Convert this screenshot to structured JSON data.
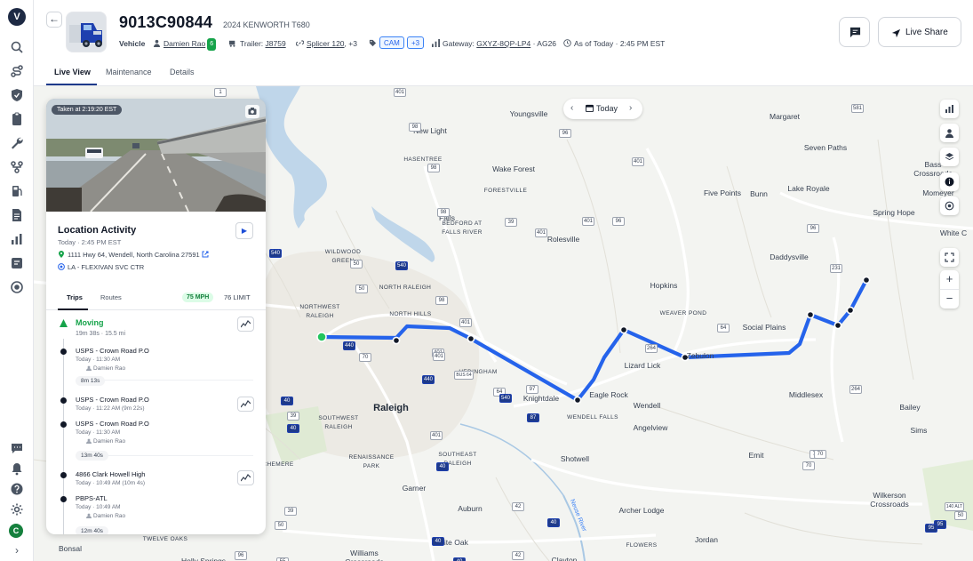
{
  "nav": {
    "logo_letter": "V",
    "items": [
      "search-icon",
      "route-icon",
      "shield-icon",
      "clipboard-icon",
      "wrench-icon",
      "workflow-icon",
      "fuel-icon",
      "document-icon",
      "chart-icon",
      "message-icon",
      "settings-circle-icon"
    ],
    "bottom": [
      "chat-icon",
      "bell-icon",
      "help-icon",
      "gear-icon"
    ],
    "avatar_letter": "C",
    "expand": "›"
  },
  "header": {
    "back": "←",
    "vehicle_id": "9013C90844",
    "model": "2024 KENWORTH T680",
    "type_label": "Vehicle",
    "driver": "Damien Rao",
    "driver_badge": "6",
    "trailer_label": "Trailer:",
    "trailer": "J8759",
    "splicer": "Splicer 120",
    "splicer_more": ", +3",
    "tag_cam": "CAM",
    "tag_more": "+3",
    "gateway_label": "Gateway:",
    "gateway": "GXYZ-8QP-LP4",
    "gateway_suffix": " · AG26",
    "as_of": "As of Today · 2:45 PM EST",
    "live_share": "Live Share"
  },
  "tabs": [
    {
      "label": "Live View",
      "active": true
    },
    {
      "label": "Maintenance",
      "active": false
    },
    {
      "label": "Details",
      "active": false
    }
  ],
  "map": {
    "date_label": "Today",
    "prev": "‹",
    "next": "›",
    "zoom_in": "+",
    "zoom_out": "−",
    "route_color": "#2563eb",
    "places": [
      {
        "name": "Youngsville",
        "cls": ""
      },
      {
        "name": "Margaret",
        "cls": ""
      },
      {
        "name": "New Light",
        "cls": ""
      },
      {
        "name": "Seven Paths",
        "cls": ""
      },
      {
        "name": "HASENTREE",
        "cls": "sm"
      },
      {
        "name": "Wake Forest",
        "cls": ""
      },
      {
        "name": "Bass\nCrossroads",
        "cls": ""
      },
      {
        "name": "FORESTVILLE",
        "cls": "sm"
      },
      {
        "name": "Five Points",
        "cls": ""
      },
      {
        "name": "Bunn",
        "cls": ""
      },
      {
        "name": "Lake Royale",
        "cls": ""
      },
      {
        "name": "Momeyer",
        "cls": ""
      },
      {
        "name": "Falls",
        "cls": ""
      },
      {
        "name": "BEDFORD AT\nFALLS RIVER",
        "cls": "sm"
      },
      {
        "name": "Spring Hope",
        "cls": ""
      },
      {
        "name": "Rolesville",
        "cls": ""
      },
      {
        "name": "White C",
        "cls": ""
      },
      {
        "name": "WILDWOOD\nGREEN",
        "cls": "sm"
      },
      {
        "name": "Daddysville",
        "cls": ""
      },
      {
        "name": "NORTH RALEIGH",
        "cls": "sm"
      },
      {
        "name": "Hopkins",
        "cls": ""
      },
      {
        "name": "NORTHWEST\nRALEIGH",
        "cls": "sm"
      },
      {
        "name": "WEAVER POND",
        "cls": "sm"
      },
      {
        "name": "NORTH HILLS",
        "cls": "sm"
      },
      {
        "name": "Social Plains",
        "cls": ""
      },
      {
        "name": "Zebulon",
        "cls": ""
      },
      {
        "name": "Lizard Lick",
        "cls": ""
      },
      {
        "name": "HEDINGHAM",
        "cls": "sm"
      },
      {
        "name": "Knightdale",
        "cls": ""
      },
      {
        "name": "Eagle Rock",
        "cls": ""
      },
      {
        "name": "Middlesex",
        "cls": ""
      },
      {
        "name": "Wendell",
        "cls": ""
      },
      {
        "name": "Bailey",
        "cls": ""
      },
      {
        "name": "Raleigh",
        "cls": "lg"
      },
      {
        "name": "WENDELL FALLS",
        "cls": "sm"
      },
      {
        "name": "SOUTHWEST\nRALEIGH",
        "cls": "sm"
      },
      {
        "name": "Angelview",
        "cls": ""
      },
      {
        "name": "Sims",
        "cls": ""
      },
      {
        "name": "RENAISSANCE\nPARK",
        "cls": "sm"
      },
      {
        "name": "SOUTHEAST\nRALEIGH",
        "cls": "sm"
      },
      {
        "name": "Emit",
        "cls": ""
      },
      {
        "name": "Shotwell",
        "cls": ""
      },
      {
        "name": "CHEMERE",
        "cls": "sm"
      },
      {
        "name": "Garner",
        "cls": ""
      },
      {
        "name": "Wilkerson\nCrossroads",
        "cls": ""
      },
      {
        "name": "Auburn",
        "cls": ""
      },
      {
        "name": "Archer Lodge",
        "cls": ""
      },
      {
        "name": "Bonsal",
        "cls": ""
      },
      {
        "name": "TWELVE OAKS",
        "cls": "sm"
      },
      {
        "name": "White Oak",
        "cls": ""
      },
      {
        "name": "FLOWERS",
        "cls": "sm"
      },
      {
        "name": "Jordan",
        "cls": ""
      },
      {
        "name": "Holly Springs",
        "cls": ""
      },
      {
        "name": "Williams\nCrossroads",
        "cls": ""
      },
      {
        "name": "Clayton",
        "cls": ""
      },
      {
        "name": "Neuse River",
        "cls": "river"
      }
    ],
    "shields": [
      {
        "t": "1",
        "i": false
      },
      {
        "t": "401",
        "i": false
      },
      {
        "t": "98",
        "i": false
      },
      {
        "t": "401",
        "i": false
      },
      {
        "t": "96",
        "i": false
      },
      {
        "t": "98",
        "i": false
      },
      {
        "t": "581",
        "i": false
      },
      {
        "t": "39",
        "i": false
      },
      {
        "t": "98",
        "i": false
      },
      {
        "t": "401",
        "i": false
      },
      {
        "t": "96",
        "i": false
      },
      {
        "t": "401",
        "i": false
      },
      {
        "t": "98",
        "i": false
      },
      {
        "t": "540",
        "i": true
      },
      {
        "t": "50",
        "i": false
      },
      {
        "t": "540",
        "i": true
      },
      {
        "t": "401",
        "i": false
      },
      {
        "t": "231",
        "i": false
      },
      {
        "t": "96",
        "i": false
      },
      {
        "t": "50",
        "i": false
      },
      {
        "t": "440",
        "i": true
      },
      {
        "t": "401",
        "i": false
      },
      {
        "t": "64",
        "i": false
      },
      {
        "t": "70",
        "i": false
      },
      {
        "t": "401",
        "i": false
      },
      {
        "t": "264",
        "i": false
      },
      {
        "t": "97",
        "i": false
      },
      {
        "t": "440",
        "i": true
      },
      {
        "t": "BUS 64",
        "i": false
      },
      {
        "t": "64",
        "i": false
      },
      {
        "t": "264",
        "i": false
      },
      {
        "t": "540",
        "i": true
      },
      {
        "t": "40",
        "i": true
      },
      {
        "t": "87",
        "i": true
      },
      {
        "t": "39",
        "i": false
      },
      {
        "t": "40",
        "i": true
      },
      {
        "t": "401",
        "i": false
      },
      {
        "t": "70",
        "i": false
      },
      {
        "t": "40",
        "i": true
      },
      {
        "t": "42",
        "i": false
      },
      {
        "t": "39",
        "i": false
      },
      {
        "t": "50",
        "i": false
      },
      {
        "t": "95",
        "i": true
      },
      {
        "t": "40",
        "i": true
      },
      {
        "t": "40",
        "i": true
      },
      {
        "t": "55",
        "i": false
      },
      {
        "t": "96",
        "i": false
      },
      {
        "t": "42",
        "i": false
      },
      {
        "t": "70",
        "i": false
      },
      {
        "t": "70",
        "i": false
      },
      {
        "t": "95",
        "i": true
      },
      {
        "t": "140 ALT",
        "i": false
      },
      {
        "t": "50",
        "i": false
      },
      {
        "t": "40",
        "i": true
      }
    ]
  },
  "panel": {
    "photo_caption": "Taken at 2:19:20 EST",
    "title": "Location Activity",
    "subtitle": "Today · 2:45 PM EST",
    "play": "▶",
    "address": "1111 Hwy 64, Wendell, North Carolina 27591",
    "site": "LA - FLEXIVAN SVC CTR",
    "tab_trips": "Trips",
    "tab_routes": "Routes",
    "speed": "75 MPH",
    "limit": "76 LIMIT",
    "moving": "Moving",
    "moving_sub": "19m 38s · 15.5 mi",
    "events": [
      {
        "title": "USPS - Crown Road P.O",
        "sub": "Today · 11:30 AM",
        "driver": "Damien Rao",
        "dur": "8m 13s"
      },
      {
        "title": "USPS - Crown Road P.O",
        "sub": "Today · 11:22 AM (9m 22s)"
      },
      {
        "title": "USPS - Crown Road P.O",
        "sub": "Today · 11:30 AM",
        "driver": "Damien Rao",
        "dur": "13m 40s"
      },
      {
        "title": "4866 Clark Howell High",
        "sub": "Today · 10:49 AM (10m 4s)"
      },
      {
        "title": "PBPS-ATL",
        "sub": "Today · 10:49 AM",
        "driver": "Damien Rao",
        "dur": "12m 40s"
      }
    ]
  }
}
